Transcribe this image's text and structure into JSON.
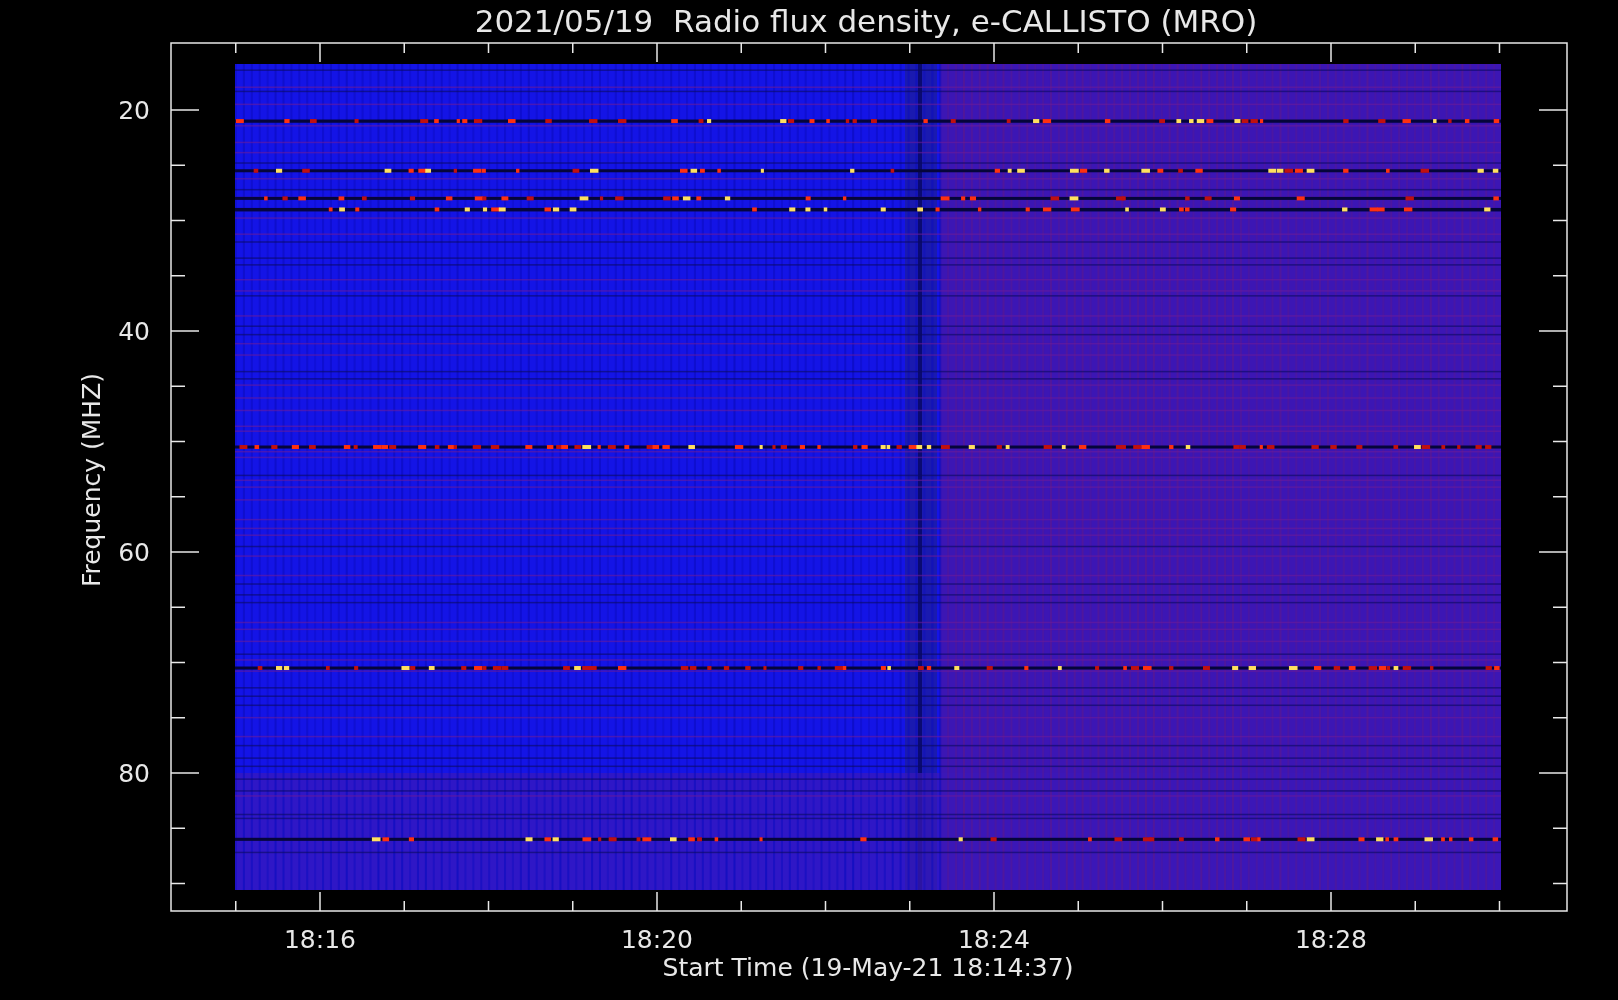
{
  "title": "2021/05/19  Radio flux density, e-CALLISTO (MRO)",
  "y_axis": {
    "label": "Frequency (MHZ)",
    "ticks": [
      "20",
      "40",
      "60",
      "80"
    ]
  },
  "x_axis": {
    "label": "Start Time (19-May-21 18:14:37)",
    "ticks": [
      "18:16",
      "18:20",
      "18:24",
      "18:28"
    ]
  }
}
